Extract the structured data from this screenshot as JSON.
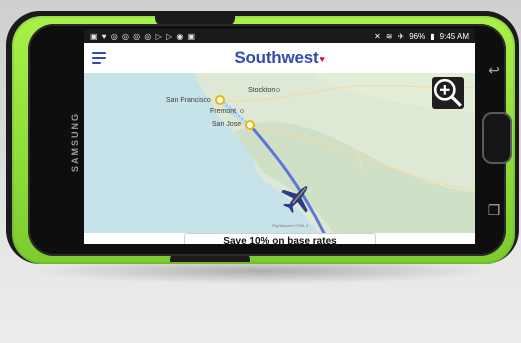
{
  "device": {
    "brand": "SAMSUNG"
  },
  "statusbar": {
    "left_icons": "▣ ♥ ◎ ◎ ◎ ◎ ▷ ▷ ◉ ▣",
    "battery": "96%",
    "time": "9:45 AM"
  },
  "app": {
    "logo_text": "Southwest",
    "brand_color": "#304cb2",
    "heart_color": "#e10f2b"
  },
  "map": {
    "cities": [
      {
        "name": "San Francisco"
      },
      {
        "name": "Stockton"
      },
      {
        "name": "Fremont"
      },
      {
        "name": "San Jose"
      }
    ],
    "attribution": "FlightAware HTML 5"
  },
  "banner": {
    "text": "Save 10% on base rates"
  },
  "icons": {
    "menu": "menu-icon",
    "zoom": "zoom-in-icon",
    "airplane": "airplane-icon"
  }
}
